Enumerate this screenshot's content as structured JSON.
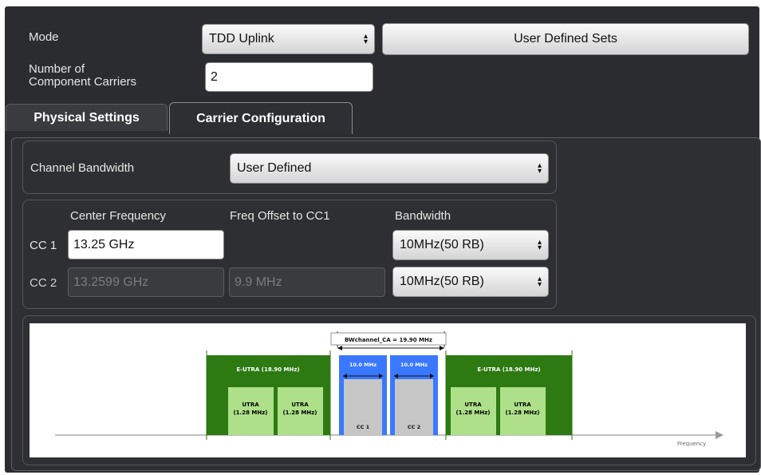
{
  "header": {
    "mode_label": "Mode",
    "mode_value": "TDD Uplink",
    "user_defined_sets_label": "User Defined Sets",
    "ncc_label_line1": "Number of",
    "ncc_label_line2": "Component Carriers",
    "ncc_value": "2"
  },
  "tabs": [
    {
      "label": "Physical Settings"
    },
    {
      "label": "Carrier Configuration"
    }
  ],
  "channel_bandwidth": {
    "label": "Channel Bandwidth",
    "value": "User Defined"
  },
  "carriers": {
    "col_center": "Center Frequency",
    "col_offset": "Freq Offset to CC1",
    "col_bandwidth": "Bandwidth",
    "rows": [
      {
        "label": "CC 1",
        "center": "13.25 GHz",
        "offset": "",
        "bandwidth": "10MHz(50 RB)"
      },
      {
        "label": "CC 2",
        "center": "13.2599 GHz",
        "offset": "9.9 MHz",
        "bandwidth": "10MHz(50 RB)"
      }
    ]
  },
  "diagram": {
    "bw_label": "BWchannel_CA = 19.90 MHz",
    "eutra_label": "E-UTRA (18.90 MHz)",
    "utra_line1": "UTRA",
    "utra_line2": "(1.28 MHz)",
    "cc_bw_label": "10.0 MHz",
    "cc1_label": "CC 1",
    "cc2_label": "CC 2",
    "axis_label": "Frequency",
    "colors": {
      "eutra": "#2d7a12",
      "utra": "#aee08a",
      "cc_blue": "#3a78ff",
      "cc_gray": "#c6c6c6"
    }
  }
}
